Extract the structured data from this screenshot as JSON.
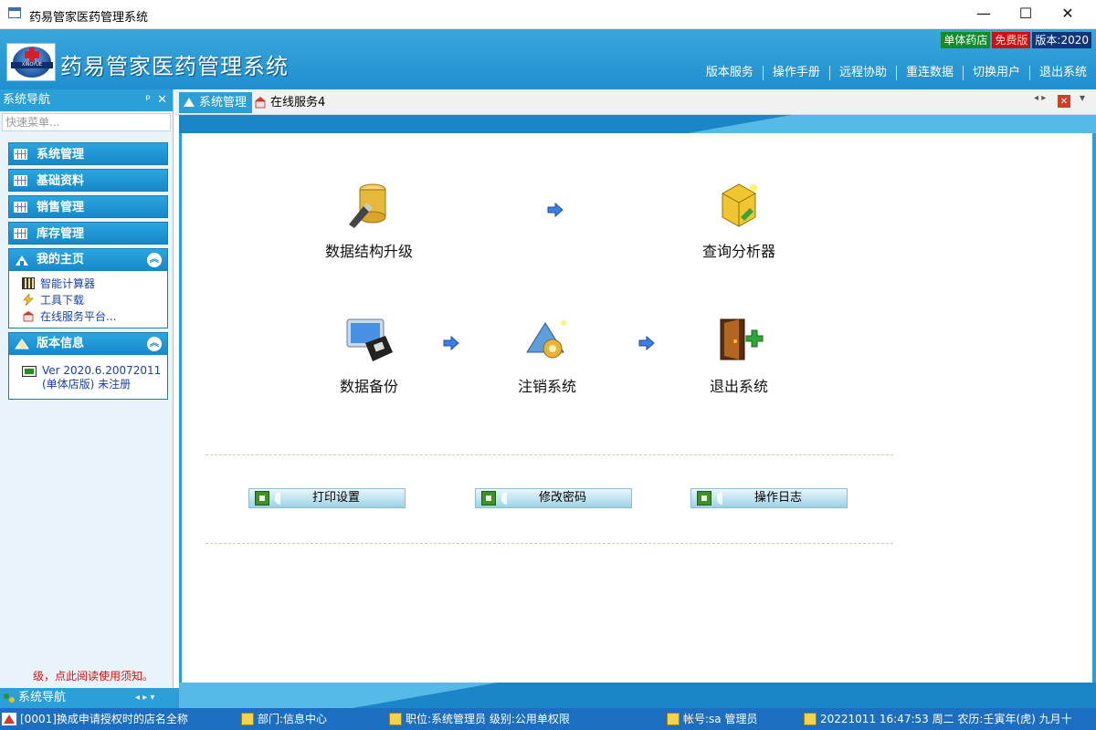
{
  "window": {
    "title": "药易管家医药管理系统",
    "controls": {
      "minimize": "—",
      "maximize": "☐",
      "close": "✕"
    }
  },
  "header": {
    "app_title": "药易管家医药管理系统",
    "logo_text": "XINOYUE",
    "badges": [
      "单体药店",
      "免费版",
      "版本:2020"
    ],
    "menu": [
      "版本服务",
      "操作手册",
      "远程协助",
      "重连数据",
      "切换用户",
      "退出系统"
    ]
  },
  "sidebar": {
    "title": "系统导航",
    "pin": "ᵖ",
    "close": "✕",
    "search_placeholder": "快速菜单...",
    "nav_items": [
      "系统管理",
      "基础资料",
      "销售管理",
      "库存管理"
    ],
    "home_panel": {
      "title": "我的主页",
      "collapse": "︽",
      "links": [
        "智能计算器",
        "工具下载",
        "在线服务平台..."
      ]
    },
    "version_panel": {
      "title": "版本信息",
      "collapse": "︽",
      "line1": "Ver 2020.6.20072011",
      "line2": "(单体店版) 未注册"
    },
    "notice": "级，点此阅读使用须知。",
    "footer_label": "系统导航",
    "footer_controls": "◂ ▸  ▾"
  },
  "tabs": {
    "items": [
      "系统管理",
      "在线服务4"
    ],
    "nav": "◂ ▸",
    "close": "✕",
    "menu": "▾"
  },
  "main": {
    "functions": [
      "数据结构升级",
      "查询分析器",
      "数据备份",
      "注销系统",
      "退出系统"
    ],
    "buttons": [
      "打印设置",
      "修改密码",
      "操作日志"
    ]
  },
  "statusbar": {
    "store": "[0001]换成申请授权时的店名全称",
    "department": "部门:信息中心",
    "position": "职位:系统管理员  级别:公用单权限",
    "account": "帐号:sa 管理员",
    "datetime": "20221011  16:47:53  周二  农历:壬寅年(虎) 九月十"
  }
}
